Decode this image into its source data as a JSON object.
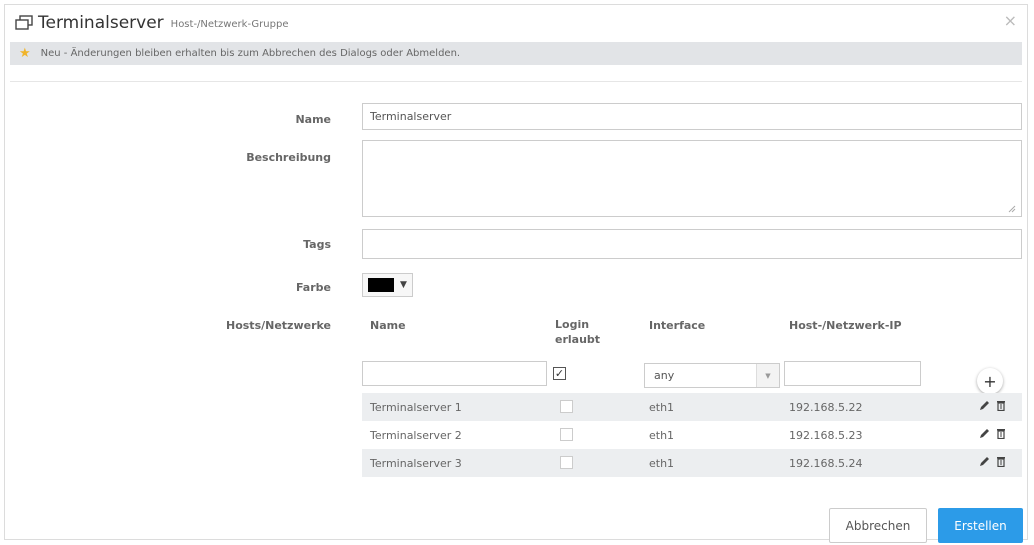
{
  "dialog": {
    "title": "Terminalserver",
    "subtitle": "Host-/Netzwerk-Gruppe",
    "close_symbol": "×",
    "close_icon": "close-icon",
    "window_icon": "window-icon"
  },
  "notice": {
    "icon": "star-icon",
    "text": "Neu - Änderungen bleiben erhalten bis zum Abbrechen des Dialogs oder Abmelden."
  },
  "form": {
    "name_label": "Name",
    "name_value": "Terminalserver",
    "description_label": "Beschreibung",
    "description_value": "",
    "tags_label": "Tags",
    "tags_value": "",
    "color_label": "Farbe",
    "color_value": "#000000",
    "hosts_label": "Hosts/Netzwerke"
  },
  "hosts": {
    "columns": {
      "name": "Name",
      "login_line1": "Login",
      "login_line2": "erlaubt",
      "interface": "Interface",
      "ip": "Host-/Netzwerk-IP"
    },
    "new_entry": {
      "name": "",
      "login_checked": true,
      "interface": "any",
      "ip": ""
    },
    "rows": [
      {
        "name": "Terminalserver 1",
        "login": false,
        "interface": "eth1",
        "ip": "192.168.5.22"
      },
      {
        "name": "Terminalserver 2",
        "login": false,
        "interface": "eth1",
        "ip": "192.168.5.23"
      },
      {
        "name": "Terminalserver 3",
        "login": false,
        "interface": "eth1",
        "ip": "192.168.5.24"
      }
    ]
  },
  "buttons": {
    "cancel": "Abbrechen",
    "create": "Erstellen",
    "add": "+"
  },
  "colors": {
    "accent": "#2c9be8",
    "notice_background": "#e2e4e7",
    "star": "#f0b42a",
    "row_stripe": "#eceef0"
  }
}
